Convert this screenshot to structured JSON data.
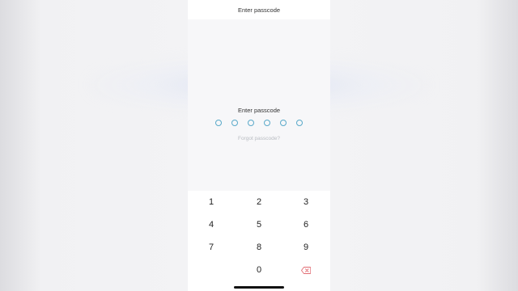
{
  "header": {
    "title": "Enter passcode"
  },
  "passcode": {
    "prompt": "Enter passcode",
    "length": 6,
    "entered": 0,
    "forgot_label": "Forgot passcode?"
  },
  "keypad": {
    "keys": [
      "1",
      "2",
      "3",
      "4",
      "5",
      "6",
      "7",
      "8",
      "9",
      "0"
    ],
    "backspace_icon": "backspace-icon"
  },
  "colors": {
    "dot_outline": "#5aa9c9",
    "backspace": "#e26d74",
    "forgot_text": "#b9bcc2"
  }
}
